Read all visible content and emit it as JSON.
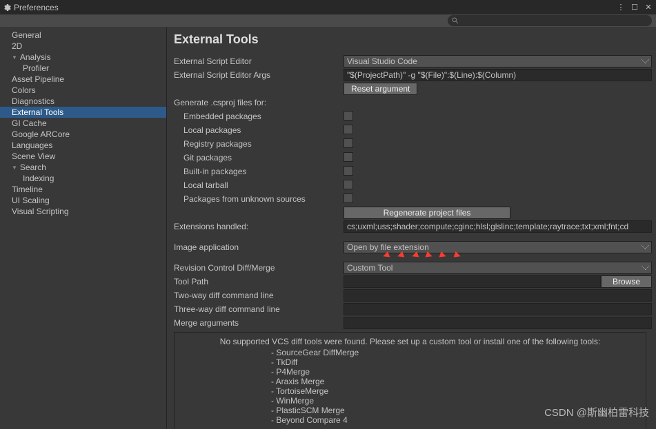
{
  "window": {
    "title": "Preferences"
  },
  "sidebar": {
    "items": [
      {
        "label": "General",
        "type": "item"
      },
      {
        "label": "2D",
        "type": "item"
      },
      {
        "label": "Analysis",
        "type": "group"
      },
      {
        "label": "Profiler",
        "type": "child"
      },
      {
        "label": "Asset Pipeline",
        "type": "item"
      },
      {
        "label": "Colors",
        "type": "item"
      },
      {
        "label": "Diagnostics",
        "type": "item"
      },
      {
        "label": "External Tools",
        "type": "item",
        "selected": true
      },
      {
        "label": "GI Cache",
        "type": "item"
      },
      {
        "label": "Google ARCore",
        "type": "item"
      },
      {
        "label": "Languages",
        "type": "item"
      },
      {
        "label": "Scene View",
        "type": "item"
      },
      {
        "label": "Search",
        "type": "group"
      },
      {
        "label": "Indexing",
        "type": "child"
      },
      {
        "label": "Timeline",
        "type": "item"
      },
      {
        "label": "UI Scaling",
        "type": "item"
      },
      {
        "label": "Visual Scripting",
        "type": "item"
      }
    ]
  },
  "page": {
    "heading": "External Tools",
    "editor_label": "External Script Editor",
    "editor_value": "Visual Studio Code",
    "args_label": "External Script Editor Args",
    "args_value": "\"$(ProjectPath)\" -g \"$(File)\":$(Line):$(Column)",
    "reset_btn": "Reset argument",
    "gen_label": "Generate .csproj files for:",
    "gen_items": [
      "Embedded packages",
      "Local packages",
      "Registry packages",
      "Git packages",
      "Built-in packages",
      "Local tarball",
      "Packages from unknown sources"
    ],
    "regen_btn": "Regenerate project files",
    "ext_label": "Extensions handled:",
    "ext_value": "cs;uxml;uss;shader;compute;cginc;hlsl;glslinc;template;raytrace;txt;xml;fnt;cd",
    "img_label": "Image application",
    "img_value": "Open by file extension",
    "rev_label": "Revision Control Diff/Merge",
    "rev_value": "Custom Tool",
    "tool_label": "Tool Path",
    "tool_value": "",
    "browse_btn": "Browse",
    "two_label": "Two-way diff command line",
    "three_label": "Three-way diff command line",
    "merge_label": "Merge arguments",
    "vcs_head": "No supported VCS diff tools were found. Please set up a custom tool or install one of the following tools:",
    "vcs_tools": [
      "SourceGear DiffMerge",
      "TkDiff",
      "P4Merge",
      "Araxis Merge",
      "TortoiseMerge",
      "WinMerge",
      "PlasticSCM Merge",
      "Beyond Compare 4"
    ]
  },
  "watermark": "CSDN @斯幽柏雷科技"
}
